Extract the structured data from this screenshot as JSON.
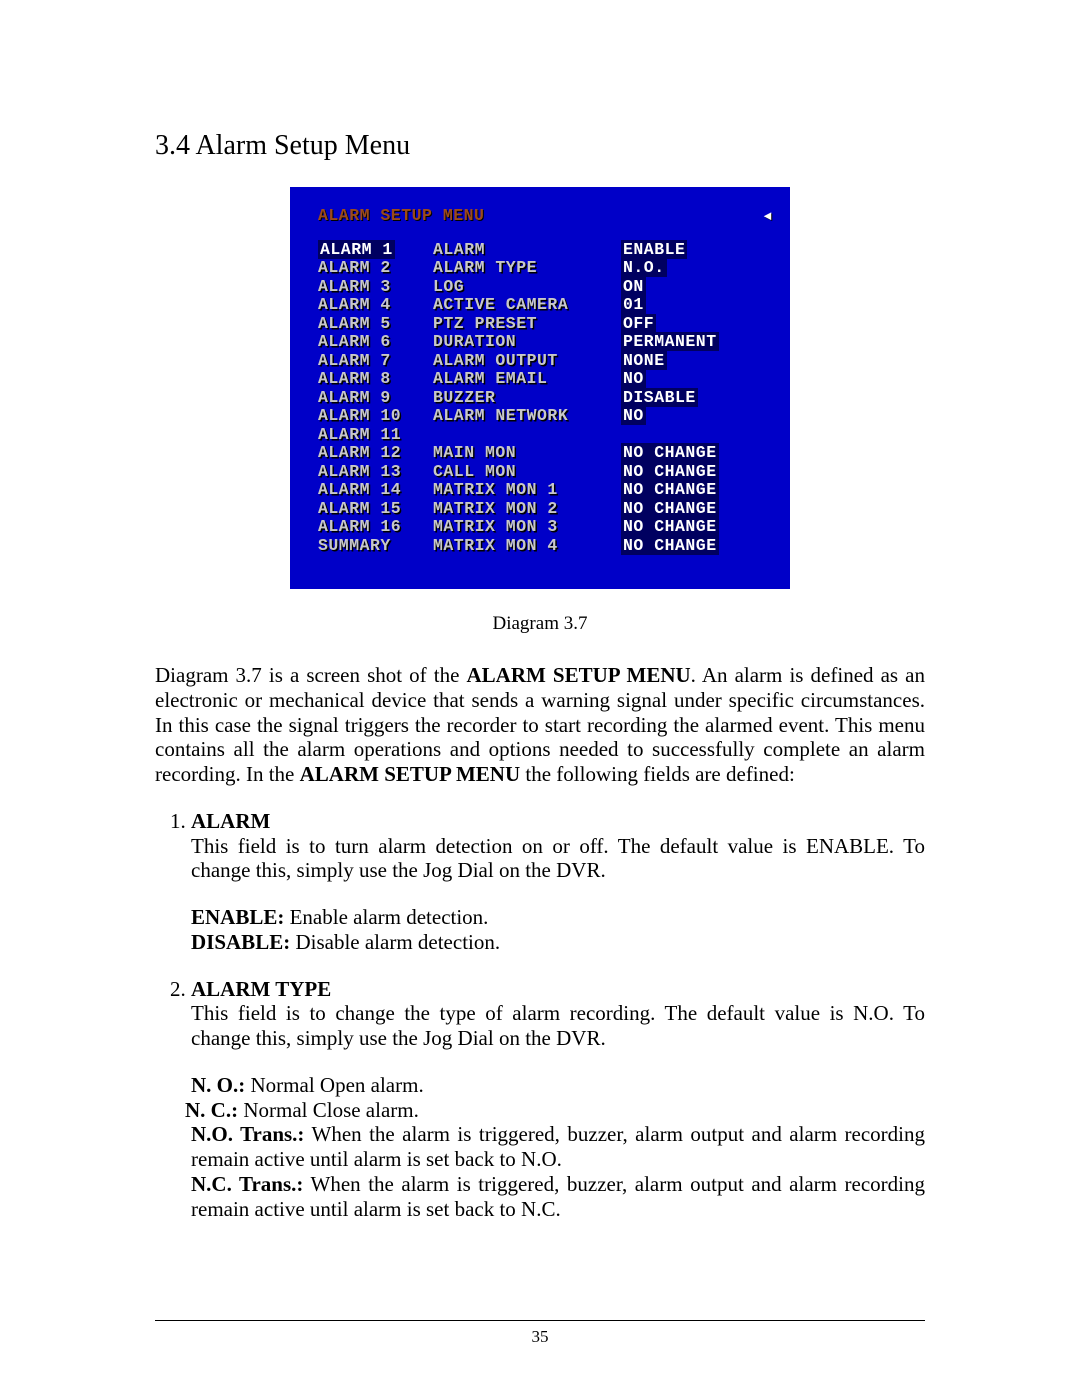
{
  "heading": "3.4    Alarm Setup Menu",
  "osd": {
    "title": "ALARM SETUP MENU",
    "back_arrow": "◄",
    "left": [
      "ALARM 1",
      "ALARM 2",
      "ALARM 3",
      "ALARM 4",
      "ALARM 5",
      "ALARM 6",
      "ALARM 7",
      "ALARM 8",
      "ALARM 9",
      "ALARM 10",
      "ALARM 11",
      "ALARM 12",
      "ALARM 13",
      "ALARM 14",
      "ALARM 15",
      "ALARM 16",
      "SUMMARY"
    ],
    "mid_top": [
      "ALARM",
      "ALARM TYPE",
      "LOG",
      "ACTIVE CAMERA",
      "PTZ PRESET",
      "DURATION",
      "ALARM OUTPUT",
      "ALARM EMAIL",
      "BUZZER",
      "ALARM NETWORK"
    ],
    "val_top": [
      "ENABLE",
      "N.O.",
      "ON",
      "01",
      "OFF",
      "PERMANENT",
      "NONE",
      "NO",
      "DISABLE",
      "NO"
    ],
    "mid_bot": [
      "MAIN MON",
      "CALL MON",
      "MATRIX MON 1",
      "MATRIX MON 2",
      "MATRIX MON 3",
      "MATRIX MON 4"
    ],
    "val_bot": [
      "NO CHANGE",
      "NO CHANGE",
      "NO CHANGE",
      "NO CHANGE",
      "NO CHANGE",
      "NO CHANGE"
    ]
  },
  "caption": "Diagram 3.7",
  "intro": {
    "lead": "Diagram 3.7 is a screen shot of the ",
    "bold1": "ALARM SETUP MENU",
    "mid": ". An alarm is defined as an electronic or mechanical device that sends a warning signal under specific circumstances. In this case the signal triggers the recorder to start recording the alarmed event. This menu contains all the alarm operations and options needed to successfully complete an alarm recording. In the ",
    "bold2": "ALARM SETUP MENU",
    "tail": " the following fields are defined:"
  },
  "items": [
    {
      "label": "ALARM",
      "body": "This field is to turn alarm detection on or off. The default value is ENABLE. To change this, simply use the Jog Dial on the DVR.",
      "opts": [
        {
          "k": "ENABLE:",
          "v": " Enable alarm detection."
        },
        {
          "k": "DISABLE:",
          "v": " Disable alarm detection."
        }
      ]
    },
    {
      "label": "ALARM TYPE",
      "body": "This field is to change the type of alarm recording. The default value is N.O. To change this, simply use the Jog Dial on the DVR.",
      "opts": [
        {
          "k": "N. O.:",
          "v": " Normal Open alarm."
        },
        {
          "k": "N. C.:",
          "v": " Normal Close alarm."
        },
        {
          "k": "N.O. Trans.:",
          "v": " When the alarm is triggered, buzzer, alarm output and alarm recording remain active until alarm is set back to N.O."
        },
        {
          "k": "N.C. Trans.:",
          "v": " When the alarm is triggered, buzzer, alarm output and alarm recording remain active until alarm is set back to N.C."
        }
      ]
    }
  ],
  "page_number": "35"
}
